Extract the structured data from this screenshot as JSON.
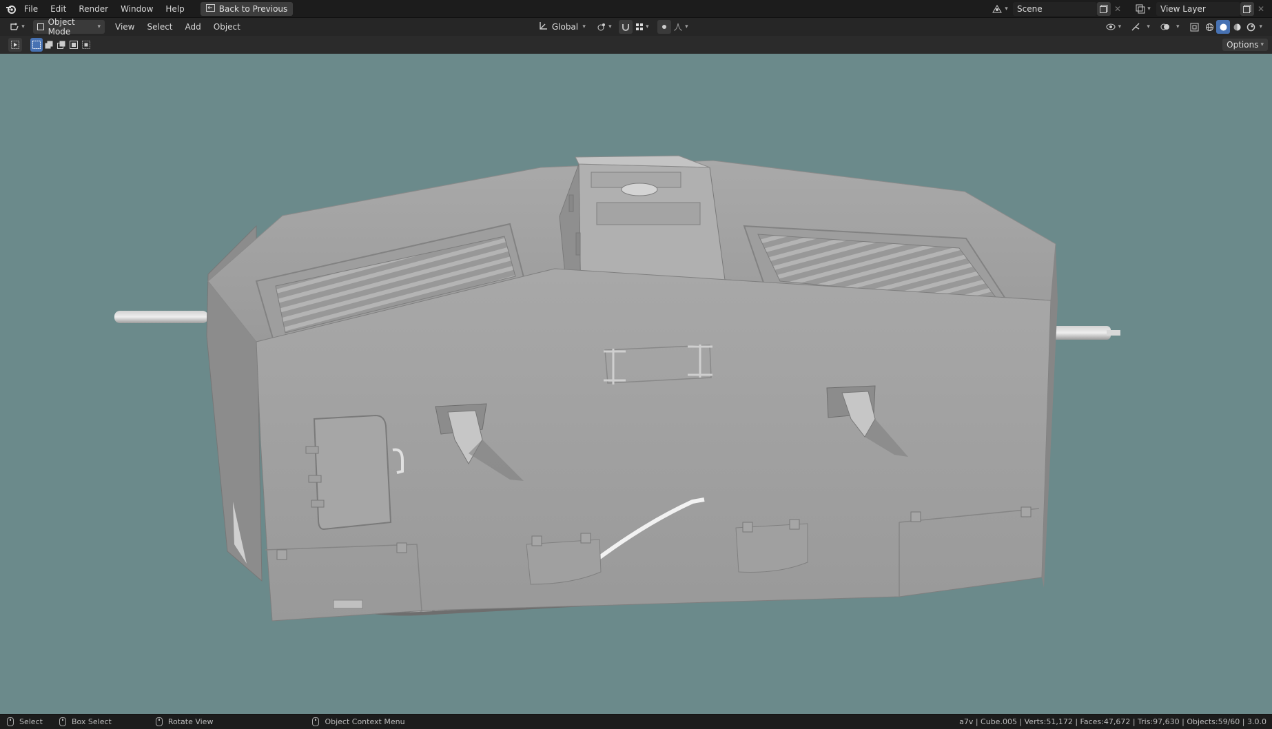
{
  "topbar": {
    "menus": [
      "File",
      "Edit",
      "Render",
      "Window",
      "Help"
    ],
    "back_button": "Back to Previous",
    "scene": "Scene",
    "view_layer": "View Layer"
  },
  "header": {
    "mode": "Object Mode",
    "menus": [
      "View",
      "Select",
      "Add",
      "Object"
    ],
    "orientation": "Global"
  },
  "toolsettings": {
    "options": "Options"
  },
  "statusbar": {
    "select": "Select",
    "box_select": "Box Select",
    "rotate_view": "Rotate View",
    "context_menu": "Object Context Menu",
    "stats": "a7v | Cube.005 | Verts:51,172 | Faces:47,672 | Tris:97,630 | Objects:59/60 | 3.0.0"
  },
  "colors": {
    "viewport_bg": "#6b8a8b",
    "accent": "#4772b3",
    "model_grey": "#a3a3a3"
  },
  "icons": [
    "blender-logo-icon",
    "back-icon",
    "editor-type-icon",
    "object-mode-icon",
    "orientation-icon",
    "pivot-icon",
    "snap-icon",
    "proportional-icon",
    "scene-icon",
    "view-layer-icon",
    "gizmo-icon",
    "overlay-icon",
    "xray-icon",
    "shading-wireframe-icon",
    "shading-solid-icon",
    "shading-material-icon",
    "shading-rendered-icon",
    "mouse-icon"
  ]
}
